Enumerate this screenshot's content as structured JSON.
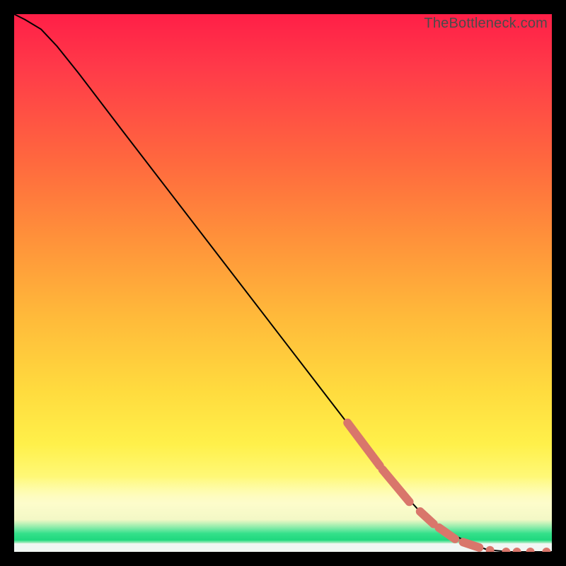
{
  "watermark": "TheBottleneck.com",
  "chart_data": {
    "type": "line",
    "title": "",
    "xlabel": "",
    "ylabel": "",
    "xlim": [
      0,
      100
    ],
    "ylim": [
      0,
      100
    ],
    "curve": {
      "name": "bottleneck-curve",
      "points": [
        {
          "x": 0.0,
          "y": 100.0
        },
        {
          "x": 2.0,
          "y": 99.0
        },
        {
          "x": 5.0,
          "y": 97.2
        },
        {
          "x": 8.0,
          "y": 94.0
        },
        {
          "x": 12.0,
          "y": 89.0
        },
        {
          "x": 20.0,
          "y": 78.5
        },
        {
          "x": 30.0,
          "y": 65.5
        },
        {
          "x": 40.0,
          "y": 52.5
        },
        {
          "x": 50.0,
          "y": 39.5
        },
        {
          "x": 60.0,
          "y": 26.5
        },
        {
          "x": 65.0,
          "y": 20.0
        },
        {
          "x": 70.0,
          "y": 13.5
        },
        {
          "x": 75.0,
          "y": 8.0
        },
        {
          "x": 80.0,
          "y": 4.0
        },
        {
          "x": 85.0,
          "y": 1.5
        },
        {
          "x": 88.0,
          "y": 0.4
        },
        {
          "x": 92.0,
          "y": 0.0
        },
        {
          "x": 100.0,
          "y": 0.0
        }
      ]
    },
    "highlight_segments": [
      {
        "x1": 62.0,
        "y1": 24.0,
        "x2": 68.0,
        "y2": 16.0
      },
      {
        "x1": 68.5,
        "y1": 15.3,
        "x2": 73.5,
        "y2": 9.3
      },
      {
        "x1": 75.5,
        "y1": 7.5,
        "x2": 78.0,
        "y2": 5.2
      },
      {
        "x1": 79.0,
        "y1": 4.5,
        "x2": 82.0,
        "y2": 2.4
      },
      {
        "x1": 83.5,
        "y1": 1.8,
        "x2": 86.5,
        "y2": 0.8
      }
    ],
    "highlight_dots": [
      {
        "x": 88.5,
        "y": 0.3
      },
      {
        "x": 91.5,
        "y": 0.0
      },
      {
        "x": 93.5,
        "y": 0.0
      },
      {
        "x": 96.0,
        "y": 0.0
      },
      {
        "x": 99.0,
        "y": 0.0
      }
    ],
    "highlight_color": "#d9766b"
  }
}
